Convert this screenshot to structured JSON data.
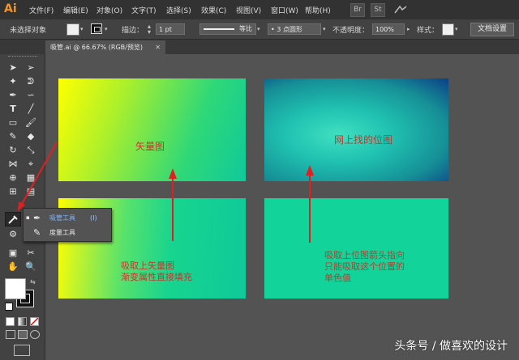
{
  "app": {
    "logo": "Ai"
  },
  "menu": [
    "文件(F)",
    "编辑(E)",
    "对象(O)",
    "文字(T)",
    "选择(S)",
    "效果(C)",
    "视图(V)",
    "窗口(W)",
    "帮助(H)"
  ],
  "app_buttons": [
    "Br",
    "St"
  ],
  "control_bar": {
    "selection_label": "未选择对象",
    "stroke_label": "描边：",
    "stroke_value": "1 pt",
    "line_style_label": "等比",
    "brush_value": "3 点圆形",
    "opacity_label": "不透明度：",
    "opacity_value": "100%",
    "style_label": "样式：",
    "doc_settings": "文档设置"
  },
  "document_tab": "吸管.ai @ 66.67% (RGB/预览)",
  "flyout": {
    "items": [
      {
        "label": "吸管工具",
        "shortcut": "(I)"
      },
      {
        "label": "度量工具",
        "shortcut": ""
      }
    ]
  },
  "artboard": {
    "top_left_label": "矢量图",
    "top_right_label": "网上找的位图",
    "bottom_left_note": [
      "吸取上矢量图",
      "渐变属性直接填充"
    ],
    "bottom_right_note": [
      "吸取上位图箭头指向",
      "只能吸取这个位置的",
      "单色值"
    ]
  },
  "watermark": "头条号 / 做喜欢的设计",
  "colors": {
    "gradient_yellow": "#ffff00",
    "gradient_green": "#00cc88",
    "bitmap_dark": "#0a4a8a",
    "solid_fill": "#12d39a",
    "annotation_red": "#e02020"
  }
}
